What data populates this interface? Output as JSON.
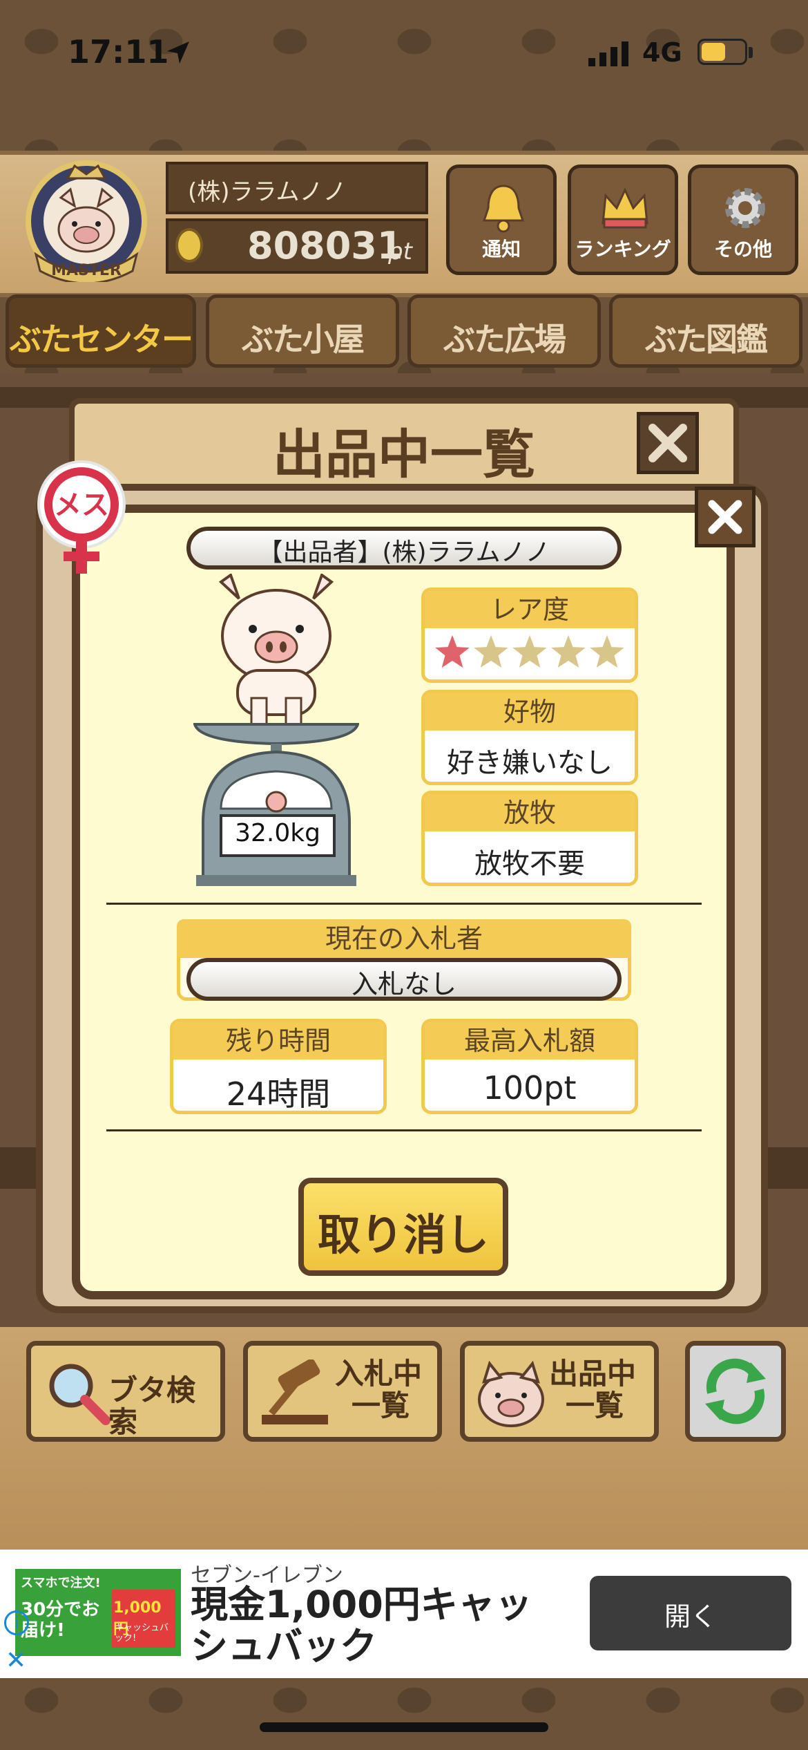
{
  "status_bar": {
    "time": "17:11",
    "network": "4G"
  },
  "header": {
    "badge_text": "MASTER",
    "user_name": "(株)ララムノノ",
    "points": "808031",
    "points_unit": "pt",
    "buttons": {
      "notify": "通知",
      "ranking": "ランキング",
      "other": "その他"
    }
  },
  "nav": {
    "tabs": [
      "ぶたセンター",
      "ぶた小屋",
      "ぶた広場",
      "ぶた図鑑"
    ],
    "active": 0
  },
  "list_panel": {
    "title": "出品中一覧"
  },
  "dialog": {
    "gender_label": "メス",
    "seller": "【出品者】(株)ララムノノ",
    "weight": "32.0kg",
    "rarity": {
      "label": "レア度",
      "stars_filled": 1,
      "stars_total": 5
    },
    "favorite": {
      "label": "好物",
      "value": "好き嫌いなし"
    },
    "grazing": {
      "label": "放牧",
      "value": "放牧不要"
    },
    "current_bidder": {
      "label": "現在の入札者",
      "value": "入札なし"
    },
    "remaining_time": {
      "label": "残り時間",
      "value": "24時間"
    },
    "max_bid": {
      "label": "最高入札額",
      "value": "100pt"
    },
    "cancel_label": "取り消し"
  },
  "bottom_bar": {
    "search": "ブタ検索",
    "bidding_line1": "入札中",
    "bidding_line2": "一覧",
    "listing_line1": "出品中",
    "listing_line2": "一覧"
  },
  "ad": {
    "brand": "セブン-イレブン",
    "headline": "現金1,000円キャッシュバック",
    "open_label": "開く",
    "image_top_text": "スマホで注文!",
    "image_main_text": "30分でお届け!",
    "image_amount": "1,000円",
    "image_sub": "キャッシュバック!"
  },
  "colors": {
    "accent_yellow": "#f4cc55",
    "wood_dark": "#5b412a",
    "panel_cream": "#fffbd1",
    "star_on": "#e0626a",
    "star_off": "#d8c58a"
  }
}
